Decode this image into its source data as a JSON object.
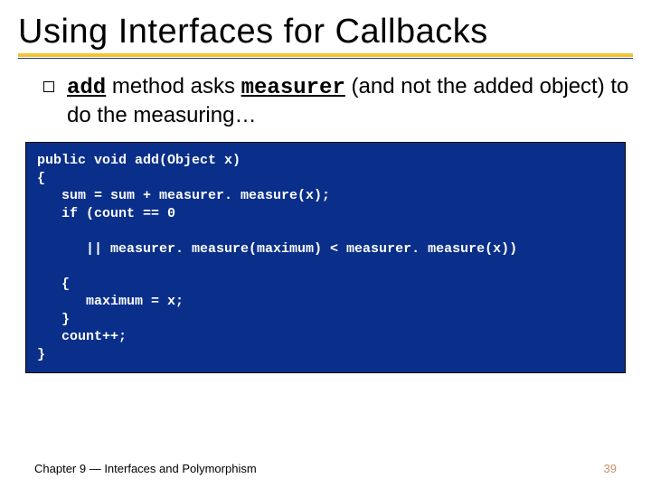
{
  "slide": {
    "title": "Using Interfaces for Callbacks",
    "bullet": {
      "text_prefix": "",
      "code1": "add",
      "mid1": " method asks ",
      "code2": "measurer",
      "mid2": " (and not the added object) to do the measuring…"
    },
    "code": "public void add(Object x)\n{\n   sum = sum + measurer. measure(x);\n   if (count == 0\n\n      || measurer. measure(maximum) < measurer. measure(x))\n\n   {\n      maximum = x;\n   }\n   count++;\n}",
    "footer_left": "Chapter 9 — Interfaces and Polymorphism",
    "footer_right": "39"
  }
}
